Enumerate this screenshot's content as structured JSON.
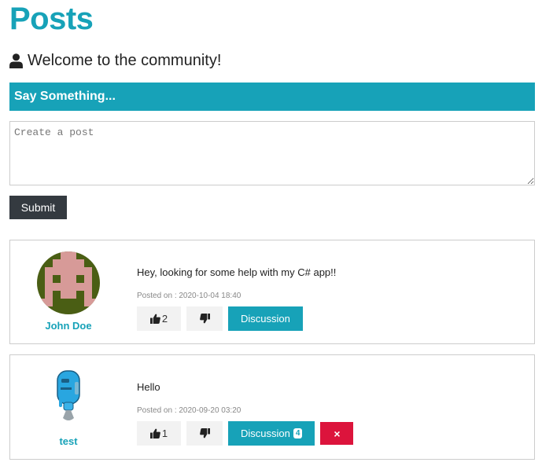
{
  "header": {
    "title": "Posts",
    "welcome_text": "Welcome to the community!"
  },
  "composer": {
    "banner": "Say Something...",
    "placeholder": "Create a post",
    "submit_label": "Submit"
  },
  "posts": [
    {
      "author": "John Doe",
      "avatar": "pixel-invader-avatar",
      "text": "Hey, looking for some help with my C# app!!",
      "posted_on": "Posted on : 2020-10-04 18:40",
      "likes": "2",
      "discussion_label": "Discussion"
    },
    {
      "author": "test",
      "avatar": "blue-robot-avatar",
      "text": "Hello",
      "posted_on": "Posted on : 2020-09-20 03:20",
      "likes": "1",
      "discussion_label": "Discussion",
      "discussion_count": "4",
      "delete_label": "×"
    }
  ],
  "colors": {
    "accent": "#17a2b8",
    "dark_button": "#343a40",
    "danger": "#dc143c",
    "light_button": "#f2f2f2"
  }
}
